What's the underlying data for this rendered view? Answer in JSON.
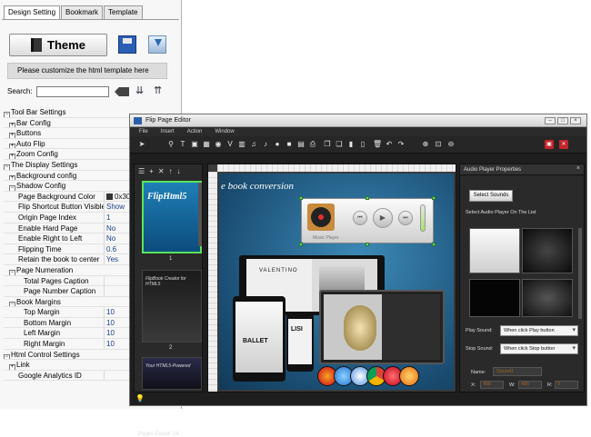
{
  "left_panel": {
    "tabs": [
      "Design Setting",
      "Bookmark",
      "Template"
    ],
    "theme_label": "Theme",
    "customize_text": "Please customize the html template here",
    "search_label": "Search:",
    "search_value": "",
    "tree": [
      {
        "label": "Tool Bar Settings",
        "level": 0,
        "box": "⊟",
        "value": ""
      },
      {
        "label": "Bar Config",
        "level": 1,
        "box": "⊞",
        "value": ""
      },
      {
        "label": "Buttons",
        "level": 1,
        "box": "⊞",
        "value": ""
      },
      {
        "label": "Auto Flip",
        "level": 1,
        "box": "⊞",
        "value": ""
      },
      {
        "label": "Zoom Config",
        "level": 1,
        "box": "⊞",
        "value": ""
      },
      {
        "label": "The Display Settings",
        "level": 0,
        "box": "⊟",
        "value": ""
      },
      {
        "label": "Background config",
        "level": 1,
        "box": "⊞",
        "value": ""
      },
      {
        "label": "Shadow Config",
        "level": 1,
        "box": "⊟",
        "value": ""
      },
      {
        "label": "Page Background Color",
        "level": 2,
        "box": "",
        "value": "0x30"
      },
      {
        "label": "Flip Shortcut Button Visible",
        "level": 2,
        "box": "",
        "value": "Show"
      },
      {
        "label": "Origin Page Index",
        "level": 2,
        "box": "",
        "value": "1"
      },
      {
        "label": "Enable Hard Page",
        "level": 2,
        "box": "",
        "value": "No"
      },
      {
        "label": "Enable Right to Left",
        "level": 2,
        "box": "",
        "value": "No"
      },
      {
        "label": "Flipping Time",
        "level": 2,
        "box": "",
        "value": "0.6"
      },
      {
        "label": "Retain the book to center",
        "level": 2,
        "box": "",
        "value": "Yes"
      },
      {
        "label": "Page Numeration",
        "level": 1,
        "box": "⊟",
        "value": ""
      },
      {
        "label": "Total Pages Caption",
        "level": 3,
        "box": "",
        "value": ""
      },
      {
        "label": "Page Number Caption",
        "level": 3,
        "box": "",
        "value": ""
      },
      {
        "label": "Book Margins",
        "level": 1,
        "box": "⊟",
        "value": ""
      },
      {
        "label": "Top Margin",
        "level": 3,
        "box": "",
        "value": "10"
      },
      {
        "label": "Bottom Margin",
        "level": 3,
        "box": "",
        "value": "10"
      },
      {
        "label": "Left Margin",
        "level": 3,
        "box": "",
        "value": "10"
      },
      {
        "label": "Right Margin",
        "level": 3,
        "box": "",
        "value": "10"
      },
      {
        "label": "Html Control Settings",
        "level": 0,
        "box": "⊟",
        "value": ""
      },
      {
        "label": "Link",
        "level": 1,
        "box": "⊞",
        "value": ""
      },
      {
        "label": "Google Analytics ID",
        "level": 2,
        "box": "",
        "value": ""
      }
    ]
  },
  "editor": {
    "title": "Flip Page Editor",
    "menu": [
      "File",
      "Insert",
      "Action",
      "Window"
    ],
    "thumb1_title": "FlipHtml5",
    "thumb2_title": "FlipBook Creator for HTML5",
    "thumb3_title": "Your HTML5-Powered",
    "thumb_numbers": [
      "1",
      "2"
    ],
    "pages_count": "Pages Count: 14",
    "canvas_text": "e book conversion",
    "music_player_label": "Music Player",
    "valentino": "VALENTINO",
    "ballet": "BALLET",
    "cover_text": "LISI"
  },
  "props": {
    "title": "Audio Player Properties",
    "select_sounds": "Select Sounds",
    "select_label": "Select Audio Player On The List",
    "play_sound_label": "Play Sound:",
    "play_sound_value": "When click Play button",
    "stop_sound_label": "Stop Sound:",
    "stop_sound_value": "When click Stop button",
    "name_label": "Name:",
    "name_value": "Sound1",
    "x_label": "X:",
    "x_value": "486",
    "w_label": "W:",
    "w_value": "486",
    "r_label": "R:",
    "r_value": "0"
  }
}
